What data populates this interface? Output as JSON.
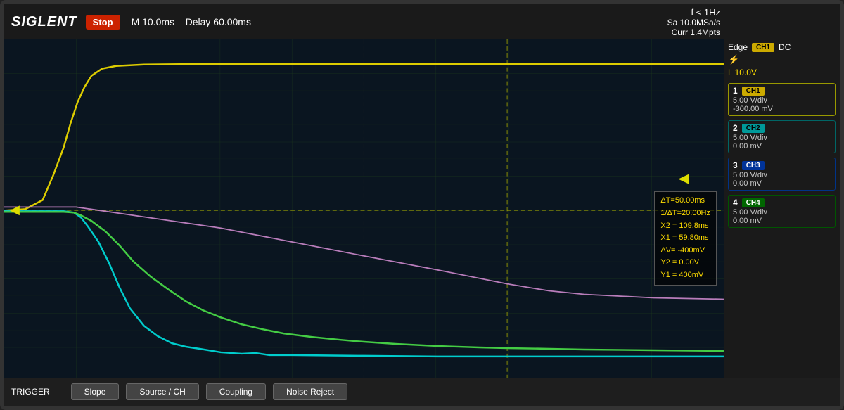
{
  "header": {
    "logo": "SIGLENT",
    "stop_label": "Stop",
    "timebase": "M 10.0ms",
    "delay": "Delay 60.00ms",
    "freq": "f < 1Hz",
    "sa": "Sa 10.0MSa/s",
    "curr": "Curr 1.4Mpts"
  },
  "trigger": {
    "edge_label": "Edge",
    "edge_badge": "CH1",
    "dc_label": "DC",
    "level": "L  10.0V"
  },
  "channels": [
    {
      "num": "1",
      "badge": "CH1",
      "color": "yellow",
      "vdiv": "5.00 V/div",
      "offset": "-300.00 mV"
    },
    {
      "num": "2",
      "badge": "CH2",
      "color": "cyan",
      "vdiv": "5.00 V/div",
      "offset": "0.00 mV"
    },
    {
      "num": "3",
      "badge": "CH3",
      "color": "blue",
      "vdiv": "5.00 V/div",
      "offset": "0.00 mV"
    },
    {
      "num": "4",
      "badge": "CH4",
      "color": "green",
      "vdiv": "5.00 V/div",
      "offset": "0.00 mV"
    }
  ],
  "measurements": {
    "delta_t": "ΔT=50.00ms",
    "inv_delta_t": "1/ΔT=20.00Hz",
    "x2": "X2 = 109.8ms",
    "x1": "X1 = 59.80ms",
    "delta_v": "ΔV= -400mV",
    "y2": "Y2 = 0.00V",
    "y1": "Y1 = 400mV"
  },
  "bottom": {
    "trigger_label": "TRIGGER",
    "btn1": "Slope",
    "btn2": "Source / CH",
    "btn3": "Coupling",
    "btn4": "Noise Reject"
  }
}
